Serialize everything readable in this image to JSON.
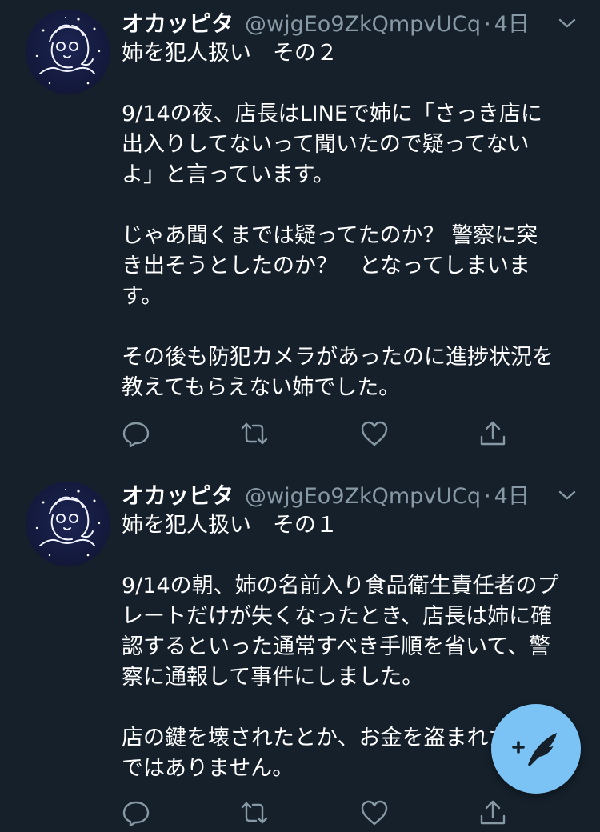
{
  "tweets": [
    {
      "name": "オカッピタ",
      "handle": "@wjgEo9ZkQmpvUCq",
      "dot": "·",
      "time": "4日",
      "lines": [
        "姉を犯人扱い　その２",
        "",
        "9/14の夜、店長はLINEで姉に「さっき店に",
        "出入りしてないって聞いたので疑ってない",
        "よ」と言っています。",
        "",
        "じゃあ聞くまでは疑ってたのか？ 警察に突",
        "き出そうとしたのか？　となってしまいま",
        "す。",
        "",
        "その後も防犯カメラがあったのに進捗状況を",
        "教えてもらえない姉でした。"
      ]
    },
    {
      "name": "オカッピタ",
      "handle": "@wjgEo9ZkQmpvUCq",
      "dot": "·",
      "time": "4日",
      "lines": [
        "姉を犯人扱い　その１",
        "",
        "9/14の朝、姉の名前入り食品衛生責任者のプ",
        "レートだけが失くなったとき、店長は姉に確",
        "認するといった通常すべき手順を省いて、警",
        "察に通報して事件にしました。",
        "",
        "店の鍵を壊されたとか、お金を盗まれたわけ",
        "ではありません。"
      ]
    }
  ],
  "colors": {
    "background": "#15202b",
    "secondary_text": "#8899a6",
    "divider": "#38444d",
    "fab": "#7bc3f5"
  },
  "icons": [
    "avatar",
    "chevron-down-icon",
    "reply-icon",
    "retweet-icon",
    "like-icon",
    "share-icon",
    "compose-tweet-icon"
  ]
}
